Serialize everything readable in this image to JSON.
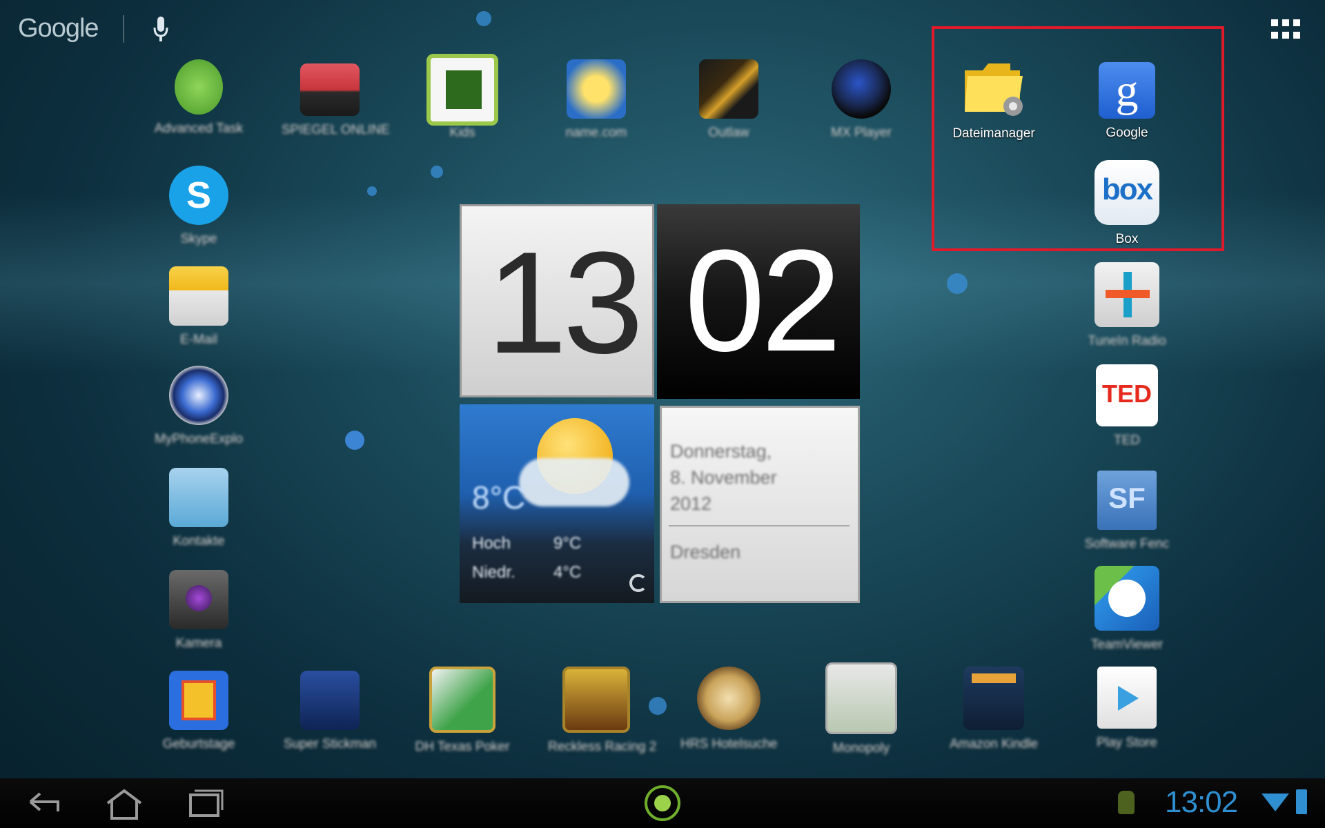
{
  "top_bar": {
    "search_label": "Google",
    "icons": [
      "microphone-icon",
      "all-apps-grid-icon"
    ]
  },
  "apps": {
    "top_row": [
      {
        "label": "Advanced Task",
        "icon": "android-task-icon",
        "color": "#6cc04a"
      },
      {
        "label": "SPIEGEL ONLINE",
        "icon": "spiegel-icon",
        "color": "#d8424a"
      },
      {
        "label": "Kids",
        "icon": "kids-icon",
        "color": "#7ab42c"
      },
      {
        "label": "name.com",
        "icon": "name-icon",
        "color": "#f2c41b"
      },
      {
        "label": "Outlaw",
        "icon": "outlaw-icon",
        "color": "#d6a02a"
      },
      {
        "label": "MX Player",
        "icon": "mx-player-icon",
        "color": "#2a4fb8"
      }
    ],
    "left_column": [
      {
        "label": "Skype",
        "icon": "skype-icon",
        "color": "#1aa2e8"
      },
      {
        "label": "E-Mail",
        "icon": "email-icon",
        "color": "#f6c43a"
      },
      {
        "label": "MyPhoneExplo",
        "icon": "sync-icon",
        "color": "#2a64c8"
      },
      {
        "label": "Kontakte",
        "icon": "contacts-icon",
        "color": "#5aa9d6"
      },
      {
        "label": "Kamera",
        "icon": "camera-icon",
        "color": "#4b4b4b"
      }
    ],
    "highlighted": [
      {
        "label": "Dateimanager",
        "icon": "folder-settings-icon",
        "color": "#f4d23c"
      },
      {
        "label": "Google",
        "icon": "google-icon",
        "color": "#2a6ee0"
      },
      {
        "label": "Box",
        "icon": "box-icon",
        "color": "#1c70c8"
      }
    ],
    "right_column": [
      {
        "label": "TuneIn Radio",
        "icon": "tunein-icon",
        "color": "#e4e4e4"
      },
      {
        "label": "TED",
        "icon": "ted-icon",
        "color": "#e62b1e"
      },
      {
        "label": "Software Fenc",
        "icon": "sf-icon",
        "color": "#4a86c8"
      },
      {
        "label": "TeamViewer",
        "icon": "teamviewer-icon",
        "color": "#2a8de0"
      }
    ],
    "bottom_row": [
      {
        "label": "Geburtstage",
        "icon": "gift-icon",
        "color": "#2a6ee0"
      },
      {
        "label": "Super Stickman",
        "icon": "stickman-icon",
        "color": "#1d3f8a"
      },
      {
        "label": "DH Texas Poker",
        "icon": "poker-icon",
        "color": "#3fa34a"
      },
      {
        "label": "Reckless Racing 2",
        "icon": "racing-icon",
        "color": "#d9b23a"
      },
      {
        "label": "HRS Hotelsuche",
        "icon": "hrs-icon",
        "color": "#c9a35a"
      },
      {
        "label": "Monopoly",
        "icon": "monopoly-icon",
        "color": "#c8c8c8"
      },
      {
        "label": "Amazon Kindle",
        "icon": "kindle-icon",
        "color": "#1e3a5e"
      },
      {
        "label": "Play Store",
        "icon": "play-store-icon",
        "color": "#f2f2f2"
      }
    ]
  },
  "clock_widget": {
    "hour": "13",
    "minute": "02",
    "weather": {
      "temperature": "8°C",
      "high_label": "Hoch",
      "high_value": "9°C",
      "low_label": "Niedr.",
      "low_value": "4°C"
    },
    "date": {
      "weekday": "Donnerstag,",
      "day_month": "8. November",
      "year": "2012",
      "city": "Dresden"
    }
  },
  "nav_bar": {
    "status_time": "13:02",
    "icons": [
      "back-icon",
      "home-icon",
      "recent-apps-icon",
      "launcher-icon",
      "android-debug-icon",
      "wifi-icon",
      "battery-icon"
    ]
  },
  "colors": {
    "highlight_border": "#e0192b",
    "status_blue": "#2f8fd0"
  }
}
